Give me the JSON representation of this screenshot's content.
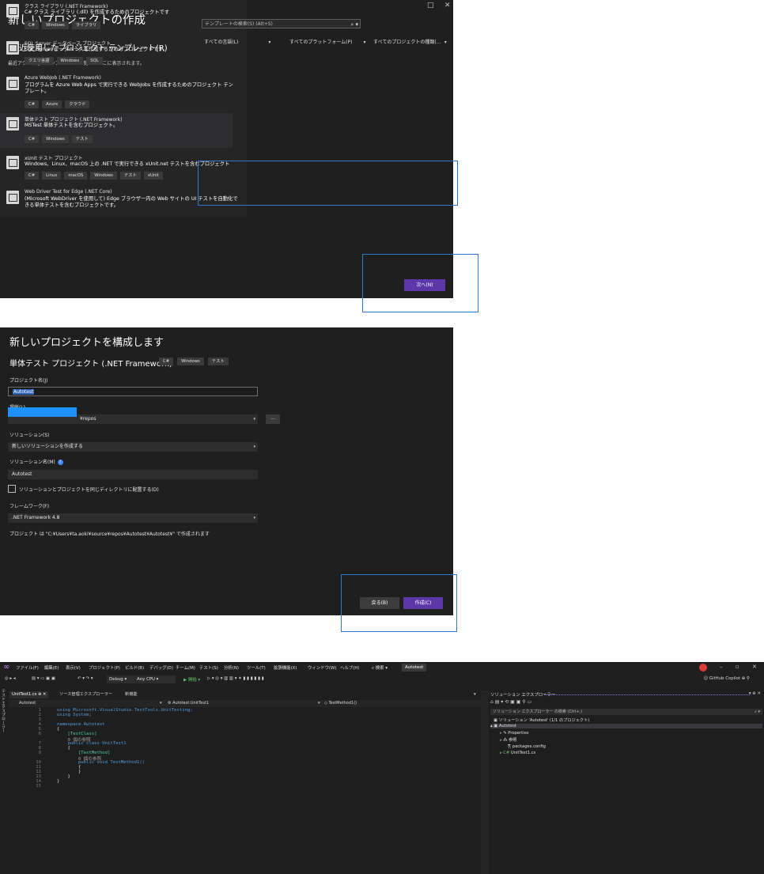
{
  "panel1": {
    "title": "新しいプロジェクトの作成",
    "window_controls": [
      "□",
      "✕"
    ],
    "recent_heading": "最近使用したプロジェクト テンプレート(R)",
    "recent_desc": "最近アクセスしたテンプレートの一覧は、ここに表示されます。",
    "search_placeholder": "テンプレートの検索(S) (Alt+S)",
    "search_icon": "search-icon",
    "filters": [
      "すべての言語(L)",
      "すべてのプラットフォーム(P)",
      "すべてのプロジェクトの種類(…"
    ],
    "templates": [
      {
        "name": "クラス ライブラリ (.NET Framework)",
        "desc": "C# クラス ライブラリ (.dll) を作成するためのプロジェクトです",
        "tags": [
          "C#",
          "Windows",
          "ライブラリ"
        ]
      },
      {
        "name": "SQL Server データベース プロジェクト",
        "desc": "SQL Server データベースを作成するためのプロジェクトです。",
        "tags": [
          "クエリ言語",
          "Windows",
          "SQL"
        ]
      },
      {
        "name": "Azure WebJob (.NET Framework)",
        "desc": "プログラムを Azure Web Apps で実行できる WebJobs を作成するためのプロジェクト テンプレート。",
        "tags": [
          "C#",
          "Azure",
          "クラウド"
        ]
      },
      {
        "name": "単体テスト プロジェクト (.NET Framework)",
        "desc": "MSTest 単体テストを含むプロジェクト。",
        "tags": [
          "C#",
          "Windows",
          "テスト"
        ]
      },
      {
        "name": "xUnit テスト プロジェクト",
        "desc": "Windows、Linux、macOS 上の .NET で実行できる xUnit.net テストを含むプロジェクト",
        "tags": [
          "C#",
          "Linux",
          "macOS",
          "Windows",
          "テスト",
          "xUnit"
        ]
      },
      {
        "name": "Web Driver Test for Edge (.NET Core)",
        "desc": "(Microsoft WebDriver を使用して) Edge ブラウザー内の Web サイトの UI テストを自動化できる単体テストを含むプロジェクトです。",
        "tags": []
      }
    ],
    "next_label": "次へ(N)"
  },
  "panel2": {
    "title": "新しいプロジェクトを構成します",
    "template_name": "単体テスト プロジェクト (.NET Framework)",
    "tags": [
      "C#",
      "Windows",
      "テスト"
    ],
    "project_name_label": "プロジェクト名(J)",
    "project_name_value": "Autotest",
    "location_label": "場所(L)",
    "location_value": "¥repos",
    "browse_label": "...",
    "solution_label": "ソリューション(S)",
    "solution_value": "新しいソリューションを作成する",
    "solution_name_label": "ソリューション名(M)",
    "solution_name_value": "Autotest",
    "same_dir_label": "ソリューションとプロジェクトを同じディレクトリに配置する(D)",
    "framework_label": "フレームワーク(F)",
    "framework_value": ".NET Framework 4.8",
    "path_note": "プロジェクト は \"C:¥Users¥ta.aoki¥source¥repos¥Autotest¥Autotest¥\" で作成されます",
    "back_label": "戻る(B)",
    "create_label": "作成(C)"
  },
  "panel3": {
    "menu": [
      "ファイル(F)",
      "編集(E)",
      "表示(V)",
      "プロジェクト(P)",
      "ビルド(B)",
      "デバッグ(D)",
      "テスト(S)",
      "分析(N)",
      "ツール(T)",
      "拡張機能(X)",
      "ウィンドウ(W)",
      "ヘルプ(H)",
      "ク(N)"
    ],
    "search_label": "検索",
    "project_badge": "Autotest",
    "toolbar": {
      "config": "Debug",
      "platform": "Any CPU",
      "start": "▶ 開始 ▾"
    },
    "copilot_label": "GitHub Copilot",
    "side_tab": "テストエクスプローラー",
    "tabs": [
      "UnitTest1.cs",
      "ソース管理エクスプローラー",
      "新機能"
    ],
    "nav": [
      "Autotest",
      "Autotest.UnitTest1",
      "TestMethod1()"
    ],
    "code": [
      {
        "n": "1",
        "t": "using Microsoft.VisualStudio.TestTools.UnitTesting;"
      },
      {
        "n": "2",
        "t": "using System;"
      },
      {
        "n": "3",
        "t": ""
      },
      {
        "n": "4",
        "t": "namespace Autotest"
      },
      {
        "n": "5",
        "t": "{"
      },
      {
        "n": "6",
        "t": "    [TestClass]"
      },
      {
        "n": "",
        "t": "    0 個の参照"
      },
      {
        "n": "7",
        "t": "    public class UnitTest1"
      },
      {
        "n": "8",
        "t": "    {"
      },
      {
        "n": "9",
        "t": "        [TestMethod]"
      },
      {
        "n": "",
        "t": "        0 個の参照"
      },
      {
        "n": "10",
        "t": "        public void TestMethod1()"
      },
      {
        "n": "11",
        "t": "        {"
      },
      {
        "n": "12",
        "t": "        }"
      },
      {
        "n": "13",
        "t": "    }"
      },
      {
        "n": "14",
        "t": "}"
      },
      {
        "n": "15",
        "t": ""
      }
    ],
    "solution_explorer": {
      "title": "ソリューション エクスプローラー",
      "search_placeholder": "ソリューション エクスプローラー の検索 (Ctrl+;)",
      "nodes": [
        {
          "label": "ソリューション 'Autotest' (1/1 のプロジェクト)",
          "indent": 0
        },
        {
          "label": "Autotest",
          "indent": 1
        },
        {
          "label": "Properties",
          "indent": 2
        },
        {
          "label": "参照",
          "indent": 2
        },
        {
          "label": "packages.config",
          "indent": 3
        },
        {
          "label": "UnitTest1.cs",
          "indent": 2
        }
      ]
    }
  }
}
